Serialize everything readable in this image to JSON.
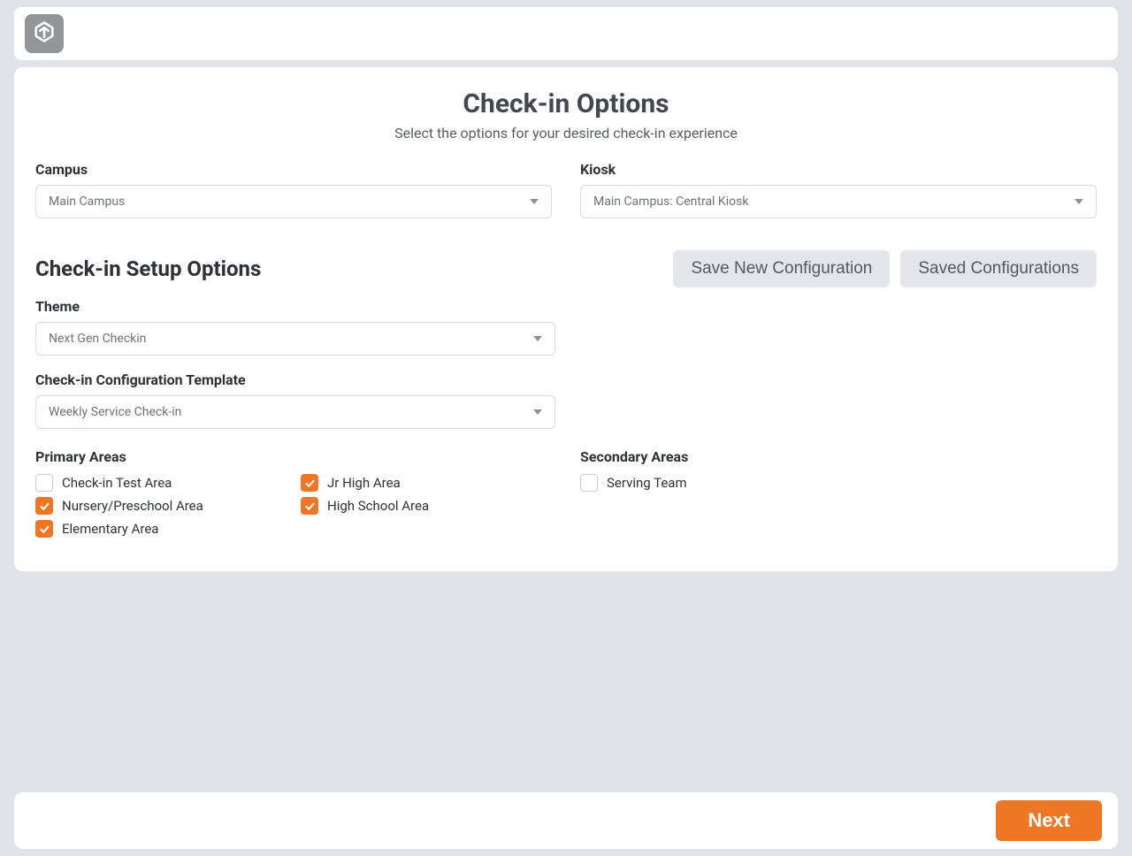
{
  "header": {
    "logo_name": "rock-rms-logo-icon"
  },
  "page": {
    "title": "Check-in Options",
    "subtitle": "Select the options for your desired check-in experience"
  },
  "fields": {
    "campus": {
      "label": "Campus",
      "value": "Main Campus"
    },
    "kiosk": {
      "label": "Kiosk",
      "value": "Main Campus: Central Kiosk"
    },
    "theme": {
      "label": "Theme",
      "value": "Next Gen Checkin"
    },
    "template": {
      "label": "Check-in Configuration Template",
      "value": "Weekly Service Check-in"
    }
  },
  "setup": {
    "heading": "Check-in Setup Options",
    "save_new": "Save New Configuration",
    "saved": "Saved Configurations"
  },
  "primary_areas": {
    "heading": "Primary Areas",
    "items": [
      {
        "label": "Check-in Test Area",
        "checked": false
      },
      {
        "label": "Nursery/Preschool Area",
        "checked": true
      },
      {
        "label": "Elementary Area",
        "checked": true
      },
      {
        "label": "Jr High Area",
        "checked": true
      },
      {
        "label": "High School Area",
        "checked": true
      }
    ]
  },
  "secondary_areas": {
    "heading": "Secondary Areas",
    "items": [
      {
        "label": "Serving Team",
        "checked": false
      }
    ]
  },
  "footer": {
    "next": "Next"
  },
  "colors": {
    "accent": "#ee7725",
    "page_bg": "#e1e3e8"
  }
}
